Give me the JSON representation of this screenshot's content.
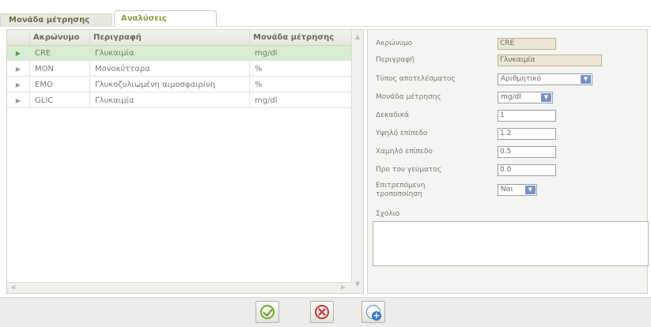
{
  "tabs": [
    {
      "label": "Μονάδα μέτρησης"
    },
    {
      "label": "Αναλύσεις"
    }
  ],
  "grid": {
    "columns": [
      "Ακρώνυμο",
      "Περιγραφή",
      "Μονάδα μέτρησης"
    ],
    "rows": [
      {
        "acronym": "CRE",
        "description": "Γλυκαιμία",
        "unit": "mg/dl"
      },
      {
        "acronym": "MON",
        "description": "Μονοκύτταρα",
        "unit": "%"
      },
      {
        "acronym": "EMO",
        "description": "Γλυκοζυλιωμένη αιμοσφαιρίνη",
        "unit": "%"
      },
      {
        "acronym": "GLIC",
        "description": "Γλυκαιμία",
        "unit": "mg/dl"
      }
    ]
  },
  "form": {
    "acronym_label": "Ακρώνυμο",
    "acronym_value": "CRE",
    "description_label": "Περιγραφή",
    "description_value": "Γλυκαιμία",
    "result_type_label": "Τύπος αποτελέσματος",
    "result_type_value": "Αριθμητικό",
    "unit_label": "Μονάδα μέτρησης",
    "unit_value": "mg/dl",
    "decimals_label": "Δεκαδικά",
    "decimals_value": "1",
    "high_label": "Υψηλό επίπεδο",
    "high_value": "1.2",
    "low_label": "Χαμηλό επίπεδο",
    "low_value": "0.5",
    "before_meal_label": "Προ του γεύματος",
    "before_meal_value": "0.0",
    "allowed_edit_label": "Επιτρεπόμενη τροποποίηση",
    "allowed_edit_value": "Ναι",
    "comment_label": "Σχόλιο",
    "comment_value": ""
  },
  "footer": {
    "buttons": [
      "ok-icon",
      "cancel-icon",
      "new-record-icon"
    ]
  },
  "colors": {
    "selected_row": "#d8ecd2",
    "active_tab_text": "#8a9a3a",
    "readonly_field": "#ece6d4"
  }
}
